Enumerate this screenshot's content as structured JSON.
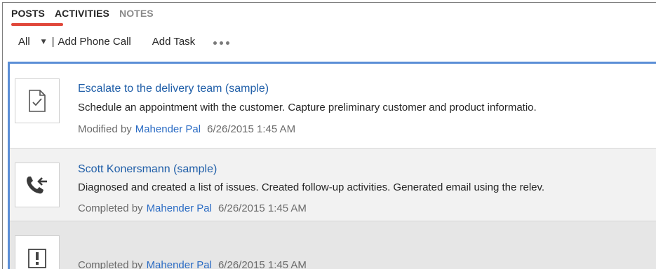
{
  "tabs": [
    {
      "label": "POSTS",
      "active": true
    },
    {
      "label": "ACTIVITIES"
    },
    {
      "label": "NOTES"
    }
  ],
  "toolbar": {
    "filter_label": "All",
    "separator": "|",
    "add_phone_call": "Add Phone Call",
    "add_task": "Add Task"
  },
  "colors": {
    "accent_underline": "#e0473a",
    "selection_border": "#5b8ed6",
    "link": "#1f5ea8"
  },
  "activities": [
    {
      "icon": "task-check-icon",
      "title": "Escalate to the delivery team (sample)",
      "description": "Schedule an appointment with the customer. Capture preliminary customer and product informatio.",
      "status": "Modified by",
      "user": "Mahender Pal",
      "timestamp": "6/26/2015 1:45 AM"
    },
    {
      "icon": "incoming-phone-call-icon",
      "title": "Scott Konersmann (sample)",
      "description": "Diagnosed and created a list of issues. Created follow-up activities. Generated email using the relev.",
      "status": "Completed by",
      "user": "Mahender Pal",
      "timestamp": "6/26/2015 1:45 AM"
    },
    {
      "icon": "task-alert-icon",
      "title": "",
      "description": "",
      "status": "Completed by",
      "user": "Mahender Pal",
      "timestamp": "6/26/2015 1:45 AM"
    }
  ]
}
